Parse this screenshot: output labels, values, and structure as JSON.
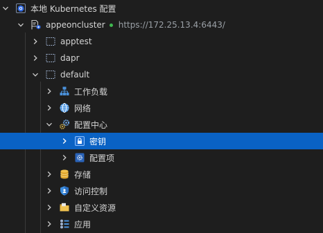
{
  "tree": {
    "root": {
      "label": "本地 Kubernetes 配置",
      "icon": "kubernetes-icon",
      "expanded": true
    },
    "cluster": {
      "label": "appeoncluster",
      "status": "connected",
      "url": "https://172.25.13.4:6443/",
      "icon": "cluster-config-icon",
      "expanded": true
    },
    "namespaces": [
      {
        "label": "apptest",
        "icon": "namespace-icon",
        "expanded": false
      },
      {
        "label": "dapr",
        "icon": "namespace-icon",
        "expanded": false
      },
      {
        "label": "default",
        "icon": "namespace-icon",
        "expanded": true
      }
    ],
    "default_children": [
      {
        "label": "工作负载",
        "icon": "workloads-icon",
        "expanded": false
      },
      {
        "label": "网络",
        "icon": "network-globe-icon",
        "expanded": false
      },
      {
        "label": "配置中心",
        "icon": "config-gears-icon",
        "expanded": true
      },
      {
        "label": "存储",
        "icon": "storage-database-icon",
        "expanded": false
      },
      {
        "label": "访问控制",
        "icon": "access-control-shield-icon",
        "expanded": false
      },
      {
        "label": "自定义资源",
        "icon": "custom-resources-folder-icon",
        "expanded": false
      },
      {
        "label": "应用",
        "icon": "applications-icon",
        "expanded": false
      }
    ],
    "config_children": [
      {
        "label": "密钥",
        "icon": "secret-lock-icon",
        "selected": true,
        "expanded": false
      },
      {
        "label": "配置项",
        "icon": "configmap-icon",
        "selected": false,
        "expanded": false
      }
    ]
  },
  "colors": {
    "background": "#1e1e1e",
    "text": "#d4d4d4",
    "selection": "#0a62c4",
    "status_connected": "#3fb950",
    "url_text": "#9aa0a6",
    "k8s_blue": "#326ce5"
  }
}
